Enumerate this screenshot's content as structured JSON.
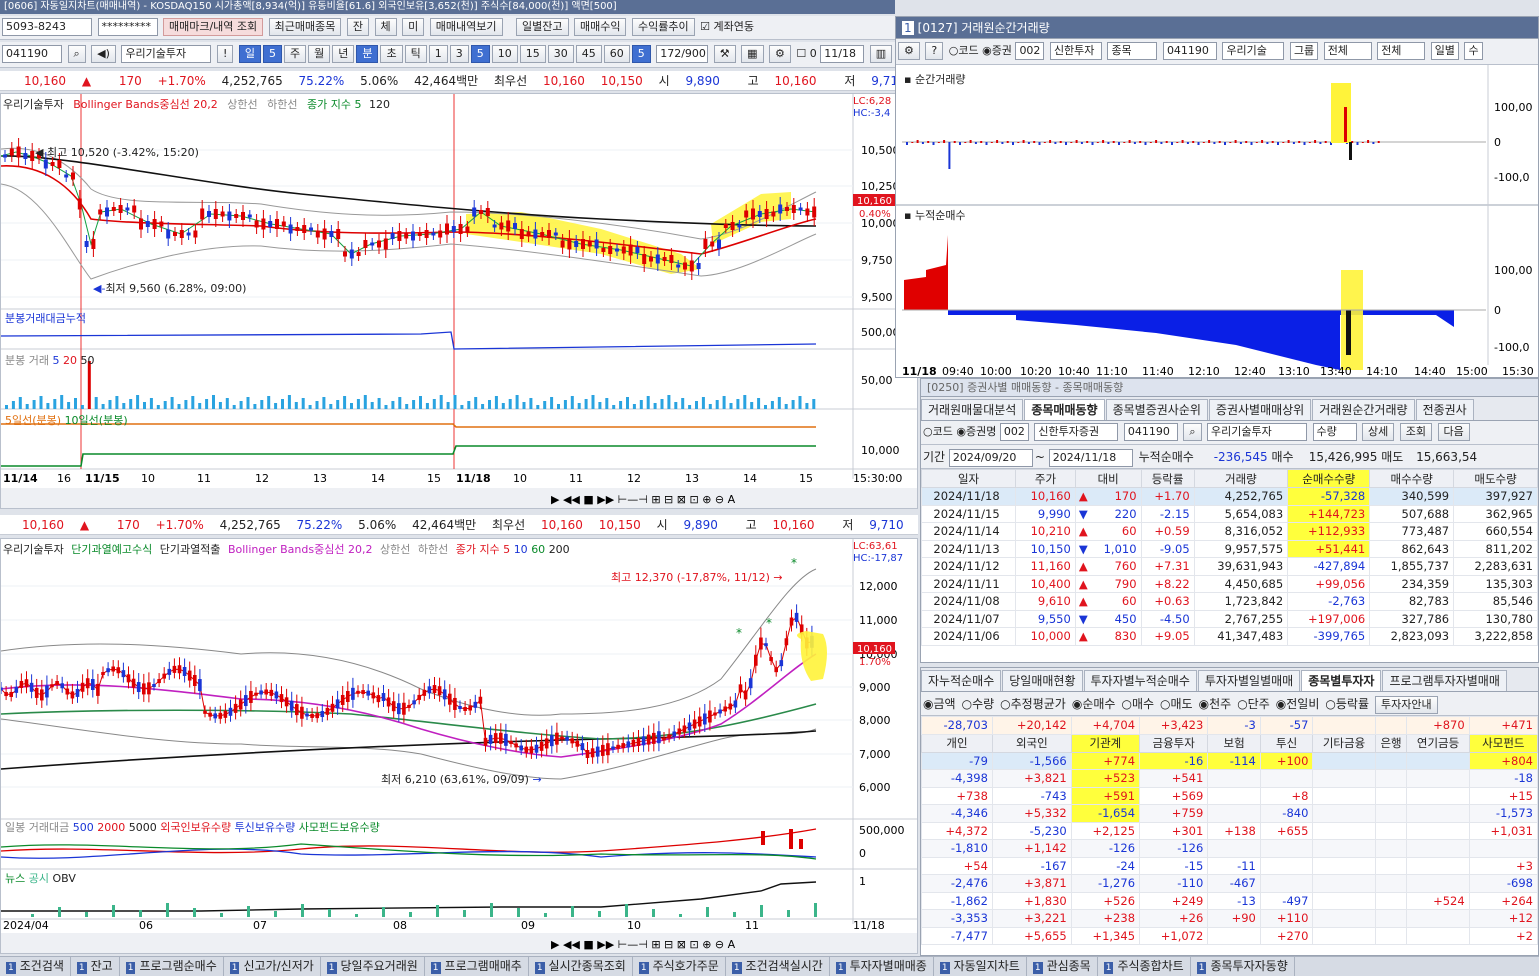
{
  "window": {
    "title": "[0606] 자동일지차트(매매내역) - KOSDAQ150 시가총액[8,934(억)] 유동비율[61.6] 외국인보유[3,652(천)] 주식수[84,000(천)] 액면[500]"
  },
  "left_toolbar": {
    "account": "5093-8243",
    "password": "*********",
    "buttons": [
      "매매마크/내역 조회",
      "최근매매종목",
      "잔",
      "체",
      "미",
      "매매내역보기",
      "일별잔고",
      "매매수익",
      "수익률추이"
    ],
    "checkbox_label": "계좌연동"
  },
  "chart_toolbar": {
    "code": "041190",
    "stock_name": "우리기술투자",
    "periods": [
      "일",
      "5",
      "주",
      "월",
      "년",
      "분",
      "초",
      "틱",
      "1",
      "3",
      "5",
      "10",
      "15",
      "30",
      "45",
      "60",
      "5"
    ],
    "count": "172/900",
    "date": "11/18"
  },
  "quote": {
    "price": "10,160",
    "arrow": "▲",
    "change": "170",
    "rate": "+1.70%",
    "volume": "4,252,765",
    "ratio1": "75.22%",
    "ratio2": "5.06%",
    "amount": "42,464백만",
    "label_prio": "최우선",
    "ask": "10,160",
    "bid": "10,150",
    "open_label": "시",
    "open": "9,890",
    "high_label": "고",
    "high": "10,160",
    "low_label": "저",
    "low": "9,710",
    "buy": "매수",
    "sell": "매도"
  },
  "upper_chart": {
    "legend": [
      "우리기술투자",
      "Bollinger Bands중심선 20,2",
      "상한선",
      "하한선",
      "종가 지수 5",
      "120"
    ],
    "corner": [
      "LC:6,28",
      "HC:-3,4"
    ],
    "y_ticks": [
      "10,500",
      "10,250",
      "10,000",
      "9,750",
      "9,500"
    ],
    "price_tag": "10,160",
    "pct_tag": "0.40%",
    "high_note": "최고 10,520 (-3.42%, 15:20)",
    "low_note": "최저 9,560 (6.28%, 09:00)",
    "sub1_legend": "분봉거래대금누적",
    "sub1_tick": "500,00",
    "sub2_legend": [
      "분봉 거래",
      "5",
      "20",
      "50"
    ],
    "sub2_tick": "50,00",
    "sub3_legend": [
      "5일선(분봉)",
      "10일선(분봉)"
    ],
    "sub3_tick": "10,000",
    "x_labels": [
      "11/14",
      "16",
      "11/15",
      "10",
      "11",
      "12",
      "13",
      "14",
      "15",
      "11/18",
      "10",
      "11",
      "12",
      "13",
      "14",
      "15",
      "15:30:00"
    ]
  },
  "lower_chart": {
    "legend": [
      "우리기술투자",
      "단기과열예고수식",
      "단기과열적출",
      "Bollinger Bands중심선 20,2",
      "상한선",
      "하한선",
      "종가 지수 5",
      "10",
      "60",
      "200"
    ],
    "corner": [
      "LC:63,61",
      "HC:-17,87"
    ],
    "y_ticks": [
      "12,000",
      "11,000",
      "10,000",
      "9,000",
      "8,000",
      "7,000",
      "6,000"
    ],
    "price_tag": "10,160",
    "pct_tag": "1.70%",
    "high_note": "최고 12,370 (-17,87%, 11/12)",
    "low_note": "최저 6,210 (63,61%, 09/09)",
    "sub1_legend": [
      "일봉 거래대금",
      "500",
      "2000",
      "5000",
      "외국인보유수량",
      "투신보유수량",
      "사모펀드보유수량"
    ],
    "sub1_ticks": [
      "500,000",
      "0"
    ],
    "sub2_legend": [
      "뉴스",
      "공시",
      "OBV"
    ],
    "sub2_tick": "1",
    "x_labels": [
      "2024/04",
      "06",
      "07",
      "08",
      "09",
      "10",
      "11",
      "11/18"
    ]
  },
  "momentary_window": {
    "title": "[0127] 거래원순간거래량",
    "toolbar": [
      "코드",
      "증권",
      "002",
      "신한투자",
      "종목",
      "041190",
      "우리기술",
      "그룹",
      "전체",
      "전체",
      "일별",
      "수"
    ],
    "panel1": "순간거래량",
    "panel2": "누적순매수",
    "y1": [
      "100,00",
      "0",
      "-100,0"
    ],
    "y2": [
      "100,00",
      "0",
      "-100,0"
    ],
    "x_labels": [
      "11/18",
      "09:40",
      "10:00",
      "10:20",
      "10:40",
      "11:10",
      "11:40",
      "12:10",
      "12:40",
      "13:10",
      "13:40",
      "14:10",
      "14:40",
      "15:00",
      "15:30"
    ]
  },
  "broker_window": {
    "title": "[0250] 증권사별 매매동향 - 종목매매동향",
    "tabs": [
      "거래원매물대분석",
      "종목매매동향",
      "종목별증권사순위",
      "증권사별매매상위",
      "거래원순간거래량",
      "전종권사"
    ],
    "active_tab": 1,
    "controls": {
      "code_label": "코드",
      "broker_label": "증권명",
      "broker_code": "002",
      "broker": "신한투자증권",
      "stock_code": "041190",
      "stock": "우리기술투자",
      "unit": "수량",
      "detail": "상세",
      "query": "조회",
      "next": "다음"
    },
    "period_label": "기간",
    "from": "2024/09/20",
    "to": "2024/11/18",
    "sum_label": "누적순매수",
    "sum": "-236,545",
    "buy_label": "매수",
    "buy": "15,426,995",
    "sell_label": "매도",
    "sell": "15,663,54",
    "columns": [
      "일자",
      "주가",
      "대비",
      "등락률",
      "거래량",
      "순매수수량",
      "매수수량",
      "매도수량"
    ],
    "rows": [
      [
        "2024/11/18",
        "10,160",
        "▲",
        "170",
        "+1.70",
        "4,252,765",
        "-57,328",
        "340,599",
        "397,927"
      ],
      [
        "2024/11/15",
        "9,990",
        "▼",
        "220",
        "-2.15",
        "5,654,083",
        "+144,723",
        "507,688",
        "362,965"
      ],
      [
        "2024/11/14",
        "10,210",
        "▲",
        "60",
        "+0.59",
        "8,316,052",
        "+112,933",
        "773,487",
        "660,554"
      ],
      [
        "2024/11/13",
        "10,150",
        "▼",
        "1,010",
        "-9.05",
        "9,957,575",
        "+51,441",
        "862,643",
        "811,202"
      ],
      [
        "2024/11/12",
        "11,160",
        "▲",
        "760",
        "+7.31",
        "39,631,943",
        "-427,894",
        "1,855,737",
        "2,283,631"
      ],
      [
        "2024/11/11",
        "10,400",
        "▲",
        "790",
        "+8.22",
        "4,450,685",
        "+99,056",
        "234,359",
        "135,303"
      ],
      [
        "2024/11/08",
        "9,610",
        "▲",
        "60",
        "+0.63",
        "1,723,842",
        "-2,763",
        "82,783",
        "85,546"
      ],
      [
        "2024/11/07",
        "9,550",
        "▼",
        "450",
        "-4.50",
        "2,767,255",
        "+197,006",
        "327,786",
        "130,780"
      ],
      [
        "2024/11/06",
        "10,000",
        "▲",
        "830",
        "+9.05",
        "41,347,483",
        "-399,765",
        "2,823,093",
        "3,222,858"
      ]
    ]
  },
  "investor_window": {
    "tabs": [
      "자누적순매수",
      "당일매매현황",
      "투자자별누적순매수",
      "투자자별일별매매",
      "종목별투자자",
      "프로그램투자자별매매"
    ],
    "active_tab": 4,
    "options": [
      "금액",
      "수량",
      "추정평균가",
      "순매수",
      "매수",
      "매도",
      "천주",
      "단주",
      "전일비",
      "등락률"
    ],
    "button": "투자자안내",
    "totals": [
      "-28,703",
      "+20,142",
      "+4,704",
      "+3,423",
      "-3",
      "-57",
      "",
      "",
      "+870",
      "+471"
    ],
    "columns": [
      "개인",
      "외국인",
      "기관계",
      "금융투자",
      "보험",
      "투신",
      "기타금융",
      "은행",
      "연기금등",
      "사모펀드"
    ],
    "rows": [
      [
        "-79",
        "-1,566",
        "+774",
        "-16",
        "-114",
        "+100",
        "",
        "",
        "",
        "+804"
      ],
      [
        "-4,398",
        "+3,821",
        "+523",
        "+541",
        "",
        "",
        "",
        "",
        "",
        "-18"
      ],
      [
        "+738",
        "-743",
        "+591",
        "+569",
        "",
        "+8",
        "",
        "",
        "",
        "+15"
      ],
      [
        "-4,346",
        "+5,332",
        "-1,654",
        "+759",
        "",
        "-840",
        "",
        "",
        "",
        "-1,573"
      ],
      [
        "+4,372",
        "-5,230",
        "+2,125",
        "+301",
        "+138",
        "+655",
        "",
        "",
        "",
        "+1,031"
      ],
      [
        "-1,810",
        "+1,142",
        "-126",
        "-126",
        "",
        "",
        "",
        "",
        "",
        ""
      ],
      [
        "+54",
        "-167",
        "-24",
        "-15",
        "-11",
        "",
        "",
        "",
        "",
        "+3"
      ],
      [
        "-2,476",
        "+3,871",
        "-1,276",
        "-110",
        "-467",
        "",
        "",
        "",
        "",
        "-698"
      ],
      [
        "-1,862",
        "+1,830",
        "+526",
        "+249",
        "-13",
        "-497",
        "",
        "",
        "+524",
        "+264"
      ],
      [
        "-3,353",
        "+3,221",
        "+238",
        "+26",
        "+90",
        "+110",
        "",
        "",
        "",
        "+12"
      ],
      [
        "-7,477",
        "+5,655",
        "+1,345",
        "+1,072",
        "",
        "+270",
        "",
        "",
        "",
        "+2"
      ]
    ]
  },
  "taskbar": [
    "조건검색",
    "잔고",
    "프로그램순매수",
    "신고가/신저가",
    "당일주요거래원",
    "프로그램매매추",
    "실시간종목조회",
    "주식호가주문",
    "조건검색실시간",
    "투자자별매매종",
    "자동일지차트",
    "관심종목",
    "주식종합차트",
    "종목투자자동향"
  ],
  "colors": {
    "up": "#e0141e",
    "down": "#1a35d6",
    "highlight": "#ffff3c",
    "title": "#5a6f95"
  }
}
